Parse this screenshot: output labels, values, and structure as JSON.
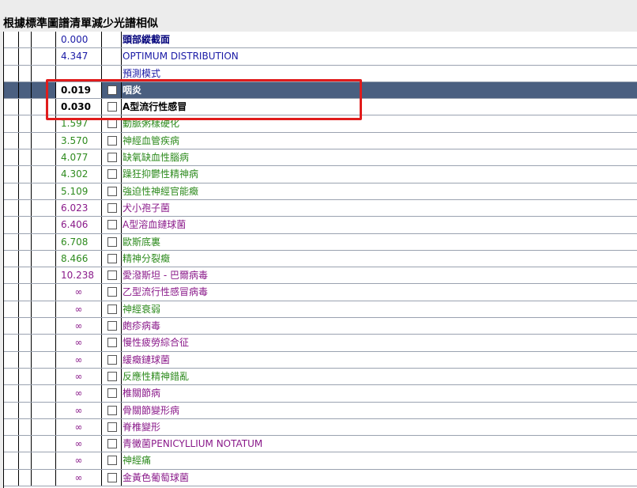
{
  "title": "根據標準圖譜清單減少光譜相似",
  "rows": [
    {
      "value": "0.000",
      "name": "頭部縱截面",
      "vcolor": "#1a1aa6",
      "ncolor": "#00007a",
      "checkbox": false,
      "style": "head"
    },
    {
      "value": "4.347",
      "name": "OPTIMUM DISTRIBUTION",
      "vcolor": "#1a1aa6",
      "ncolor": "#1a1aa6",
      "checkbox": false,
      "style": ""
    },
    {
      "value": "",
      "name": "預測模式",
      "vcolor": "#1a1aa6",
      "ncolor": "#1a1aa6",
      "checkbox": false,
      "style": ""
    },
    {
      "value": "0.019",
      "name": "咽炎",
      "vcolor": "#000000",
      "ncolor": "#ffffff",
      "checkbox": true,
      "style": "sel"
    },
    {
      "value": "0.030",
      "name": "A型流行性感冒",
      "vcolor": "#000000",
      "ncolor": "#000000",
      "checkbox": true,
      "style": "bold"
    },
    {
      "value": "1.597",
      "name": "動脈粥樣硬化",
      "vcolor": "#2e8b1e",
      "ncolor": "#2e8b1e",
      "checkbox": true,
      "style": ""
    },
    {
      "value": "3.570",
      "name": "神經血管疾病",
      "vcolor": "#2e8b1e",
      "ncolor": "#2e8b1e",
      "checkbox": true,
      "style": ""
    },
    {
      "value": "4.077",
      "name": "缺氧缺血性腦病",
      "vcolor": "#2e8b1e",
      "ncolor": "#2e8b1e",
      "checkbox": true,
      "style": ""
    },
    {
      "value": "4.302",
      "name": "躁狂抑鬱性精神病",
      "vcolor": "#2e8b1e",
      "ncolor": "#2e8b1e",
      "checkbox": true,
      "style": ""
    },
    {
      "value": "5.109",
      "name": "強迫性神經官能癥",
      "vcolor": "#2e8b1e",
      "ncolor": "#2e8b1e",
      "checkbox": true,
      "style": ""
    },
    {
      "value": "6.023",
      "name": "犬小孢子菌",
      "vcolor": "#8a1a8a",
      "ncolor": "#8a1a8a",
      "checkbox": true,
      "style": ""
    },
    {
      "value": "6.406",
      "name": "A型溶血鏈球菌",
      "vcolor": "#8a1a8a",
      "ncolor": "#8a1a8a",
      "checkbox": true,
      "style": ""
    },
    {
      "value": "6.708",
      "name": "歐斯底裏",
      "vcolor": "#2e8b1e",
      "ncolor": "#2e8b1e",
      "checkbox": true,
      "style": ""
    },
    {
      "value": "8.466",
      "name": "精神分裂癥",
      "vcolor": "#2e8b1e",
      "ncolor": "#2e8b1e",
      "checkbox": true,
      "style": ""
    },
    {
      "value": "10.238",
      "name": "愛潑斯坦 - 巴爾病毒",
      "vcolor": "#8a1a8a",
      "ncolor": "#8a1a8a",
      "checkbox": true,
      "style": ""
    },
    {
      "value": "∞",
      "name": "乙型流行性感冒病毒",
      "vcolor": "#8a1a8a",
      "ncolor": "#8a1a8a",
      "checkbox": true,
      "style": "inf"
    },
    {
      "value": "∞",
      "name": "神經衰弱",
      "vcolor": "#8a1a8a",
      "ncolor": "#2e8b1e",
      "checkbox": true,
      "style": "inf"
    },
    {
      "value": "∞",
      "name": "皰疹病毒",
      "vcolor": "#8a1a8a",
      "ncolor": "#8a1a8a",
      "checkbox": true,
      "style": "inf"
    },
    {
      "value": "∞",
      "name": "慢性疲勞綜合征",
      "vcolor": "#8a1a8a",
      "ncolor": "#8a1a8a",
      "checkbox": true,
      "style": "inf"
    },
    {
      "value": "∞",
      "name": "緩癥鏈球菌",
      "vcolor": "#8a1a8a",
      "ncolor": "#8a1a8a",
      "checkbox": true,
      "style": "inf"
    },
    {
      "value": "∞",
      "name": "反應性精神錯亂",
      "vcolor": "#8a1a8a",
      "ncolor": "#2e8b1e",
      "checkbox": true,
      "style": "inf"
    },
    {
      "value": "∞",
      "name": "椎關節病",
      "vcolor": "#8a1a8a",
      "ncolor": "#8a1a8a",
      "checkbox": true,
      "style": "inf"
    },
    {
      "value": "∞",
      "name": "骨關節變形病",
      "vcolor": "#8a1a8a",
      "ncolor": "#8a1a8a",
      "checkbox": true,
      "style": "inf"
    },
    {
      "value": "∞",
      "name": "脊椎變形",
      "vcolor": "#8a1a8a",
      "ncolor": "#8a1a8a",
      "checkbox": true,
      "style": "inf"
    },
    {
      "value": "∞",
      "name": "青黴菌PENICYLLIUM  NOTATUM",
      "vcolor": "#8a1a8a",
      "ncolor": "#8a1a8a",
      "checkbox": true,
      "style": "inf"
    },
    {
      "value": "∞",
      "name": "神經痛",
      "vcolor": "#8a1a8a",
      "ncolor": "#2e8b1e",
      "checkbox": true,
      "style": "inf"
    },
    {
      "value": "∞",
      "name": "金黃色葡萄球菌",
      "vcolor": "#8a1a8a",
      "ncolor": "#8a1a8a",
      "checkbox": true,
      "style": "inf"
    }
  ]
}
